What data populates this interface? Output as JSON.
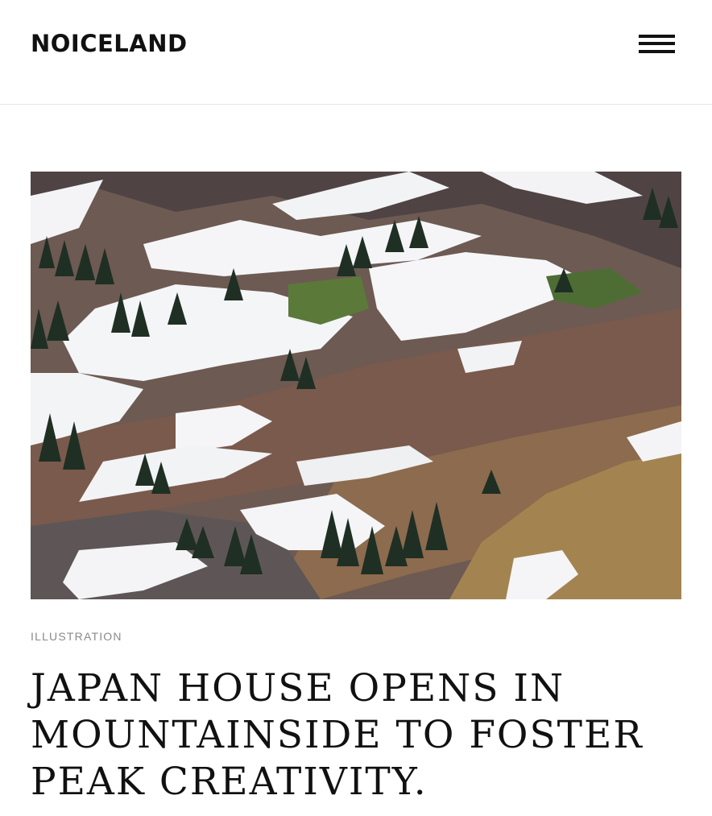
{
  "header": {
    "logo": "NOICELAND",
    "menu_icon": "hamburger-menu-icon"
  },
  "hero_image": {
    "subject": "mountain-slope-with-snow-and-pines"
  },
  "article": {
    "category": "ILLUSTRATION",
    "title": "JAPAN HOUSE OPENS IN MOUNTAINSIDE TO FOSTER PEAK CREATIVITY."
  },
  "colors": {
    "text": "#111111",
    "muted": "#8a8a8a",
    "divider": "#e6e6e6"
  }
}
